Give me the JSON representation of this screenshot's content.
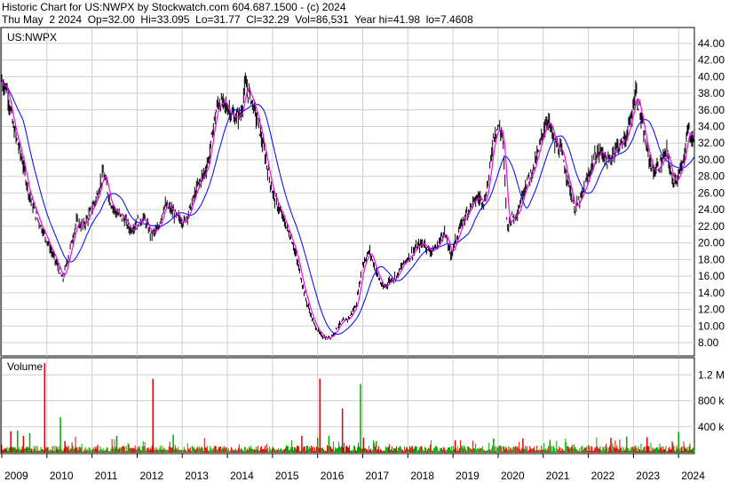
{
  "header": {
    "line1": "Historic Chart for US:NWPX by Stockwatch.com 604.687.1500 - (c) 2024",
    "line2": "Thu May  2 2024  Op=32.00  Hi=33.095  Lo=31.77  Cl=32.29  Vol=86,531  Year hi=41.98  lo=7.4608"
  },
  "colors": {
    "background": "#ffffff",
    "grid": "#cfcfcf",
    "price_bars": "#000000",
    "ma_short": "#ff00ff",
    "ma_long": "#0000ff",
    "volume_up": "#00aa00",
    "volume_down": "#dd0000"
  },
  "chart_data": [
    {
      "type": "line",
      "label": "US:NWPX",
      "y_tick_labels": [
        "8.00",
        "10.00",
        "12.00",
        "14.00",
        "16.00",
        "18.00",
        "20.00",
        "22.00",
        "24.00",
        "26.00",
        "28.00",
        "30.00",
        "32.00",
        "34.00",
        "36.00",
        "38.00",
        "40.00",
        "42.00",
        "44.00"
      ],
      "ylim": [
        6.4,
        45.8
      ],
      "x_labels": [
        "2009",
        "2010",
        "2011",
        "2012",
        "2013",
        "2014",
        "2015",
        "2016",
        "2017",
        "2018",
        "2019",
        "2020",
        "2021",
        "2022",
        "2023",
        "2024"
      ],
      "xlim": [
        2009.0,
        2024.35
      ],
      "grid": true,
      "series": [
        {
          "name": "",
          "x": [
            2009.0,
            2009.12,
            2009.25,
            2009.45,
            2009.6,
            2009.75,
            2009.95,
            2010.1,
            2010.25,
            2010.35,
            2010.5,
            2010.65,
            2010.8,
            2010.95,
            2011.1,
            2011.25,
            2011.4,
            2011.55,
            2011.7,
            2011.85,
            2012.0,
            2012.15,
            2012.3,
            2012.45,
            2012.6,
            2012.75,
            2012.9,
            2013.05,
            2013.2,
            2013.35,
            2013.5,
            2013.6,
            2013.7,
            2013.8,
            2013.95,
            2014.05,
            2014.15,
            2014.3,
            2014.4,
            2014.55,
            2014.7,
            2014.85,
            2015.0,
            2015.15,
            2015.3,
            2015.45,
            2015.6,
            2015.75,
            2015.9,
            2016.05,
            2016.2,
            2016.35,
            2016.45,
            2016.55,
            2016.7,
            2016.85,
            2017.0,
            2017.15,
            2017.3,
            2017.45,
            2017.6,
            2017.75,
            2017.9,
            2018.05,
            2018.2,
            2018.35,
            2018.5,
            2018.65,
            2018.8,
            2018.95,
            2019.1,
            2019.25,
            2019.4,
            2019.55,
            2019.7,
            2019.8,
            2019.9,
            2020.0,
            2020.1,
            2020.2,
            2020.3,
            2020.45,
            2020.6,
            2020.75,
            2020.9,
            2021.0,
            2021.1,
            2021.25,
            2021.4,
            2021.55,
            2021.7,
            2021.85,
            2022.0,
            2022.15,
            2022.3,
            2022.45,
            2022.6,
            2022.75,
            2022.85,
            2022.95,
            2023.05,
            2023.2,
            2023.3,
            2023.45,
            2023.6,
            2023.75,
            2023.85,
            2024.0,
            2024.1,
            2024.2,
            2024.3
          ],
          "y": [
            39.5,
            38.5,
            34.0,
            30.0,
            26.0,
            23.5,
            21.0,
            19.0,
            17.0,
            15.5,
            19.0,
            22.5,
            22.0,
            23.5,
            25.5,
            28.5,
            25.0,
            23.5,
            23.0,
            21.5,
            22.5,
            23.0,
            21.0,
            21.5,
            24.5,
            24.0,
            23.0,
            22.5,
            24.5,
            27.0,
            28.5,
            30.5,
            34.5,
            37.0,
            36.5,
            36.0,
            35.0,
            35.5,
            39.0,
            37.0,
            34.0,
            30.0,
            26.0,
            24.0,
            22.0,
            20.0,
            16.5,
            13.0,
            10.5,
            9.0,
            8.5,
            9.0,
            10.0,
            10.5,
            11.0,
            12.5,
            17.5,
            19.0,
            16.5,
            14.5,
            15.5,
            16.0,
            17.5,
            18.5,
            19.5,
            20.0,
            19.0,
            19.5,
            21.5,
            18.5,
            21.0,
            23.0,
            24.5,
            25.5,
            25.0,
            28.0,
            33.0,
            34.0,
            33.0,
            22.0,
            23.0,
            24.0,
            27.0,
            28.5,
            31.0,
            33.5,
            35.0,
            32.0,
            31.0,
            27.5,
            24.0,
            25.5,
            28.0,
            30.5,
            31.0,
            29.5,
            31.5,
            32.0,
            33.0,
            35.0,
            38.5,
            34.0,
            31.0,
            28.5,
            29.5,
            31.0,
            27.5,
            28.0,
            29.5,
            34.0,
            32.3
          ]
        }
      ]
    },
    {
      "type": "bar",
      "label": "Volume",
      "y_tick_labels": [
        "400 k",
        "800 k",
        "1.2 M"
      ],
      "ylim": [
        0,
        1450000
      ],
      "grid": true,
      "series": [
        {
          "name": "",
          "x": [
            2009.2,
            2009.35,
            2009.48,
            2009.62,
            2009.95,
            2010.3,
            2010.4,
            2011.55,
            2012.35,
            2012.8,
            2015.65,
            2016.0,
            2016.05,
            2016.25,
            2016.55,
            2016.95,
            2017.02,
            2017.3,
            2019.05,
            2019.9,
            2020.55,
            2021.15,
            2022.5,
            2022.85,
            2023.3,
            2024.0
          ],
          "values": [
            330000,
            340000,
            260000,
            300000,
            1380000,
            550000,
            180000,
            260000,
            1140000,
            280000,
            260000,
            230000,
            1140000,
            260000,
            680000,
            1060000,
            230000,
            180000,
            190000,
            220000,
            220000,
            200000,
            230000,
            250000,
            240000,
            320000
          ]
        }
      ]
    }
  ]
}
